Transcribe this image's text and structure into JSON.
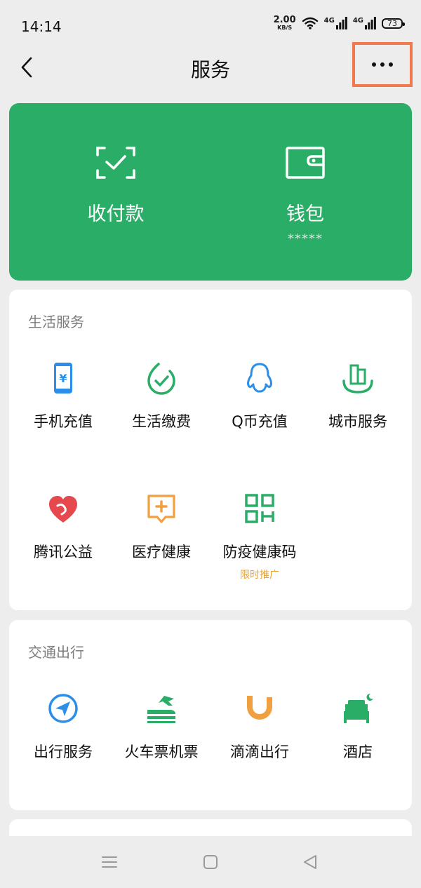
{
  "status": {
    "time": "14:14",
    "net_speed_value": "2.00",
    "net_speed_unit": "KB/S",
    "signal1": "4G",
    "signal2": "4G",
    "battery": "73"
  },
  "navbar": {
    "title": "服务"
  },
  "wallet": {
    "pay_label": "收付款",
    "wallet_label": "钱包",
    "wallet_balance": "*****",
    "card_color": "#2aae67"
  },
  "sections": {
    "life": {
      "title": "生活服务",
      "items": [
        {
          "label": "手机充值",
          "icon": "phone-recharge-icon"
        },
        {
          "label": "生活缴费",
          "icon": "utility-payment-icon"
        },
        {
          "label": "Q币充值",
          "icon": "qq-penguin-icon"
        },
        {
          "label": "城市服务",
          "icon": "city-service-icon"
        },
        {
          "label": "腾讯公益",
          "icon": "charity-heart-icon"
        },
        {
          "label": "医疗健康",
          "icon": "medical-icon"
        },
        {
          "label": "防疫健康码",
          "icon": "qr-code-icon",
          "promo": "限时推广"
        }
      ]
    },
    "travel": {
      "title": "交通出行",
      "items": [
        {
          "label": "出行服务",
          "icon": "navigation-icon"
        },
        {
          "label": "火车票机票",
          "icon": "train-plane-icon"
        },
        {
          "label": "滴滴出行",
          "icon": "didi-icon"
        },
        {
          "label": "酒店",
          "icon": "hotel-bed-icon"
        }
      ]
    }
  },
  "colors": {
    "accent_green": "#2aae67",
    "promo_orange": "#e8a133",
    "highlight_border": "#f07a4d",
    "icon_blue": "#2c8ee8",
    "icon_green": "#2aae67",
    "icon_orange": "#f0a041",
    "icon_red": "#e5484d"
  }
}
